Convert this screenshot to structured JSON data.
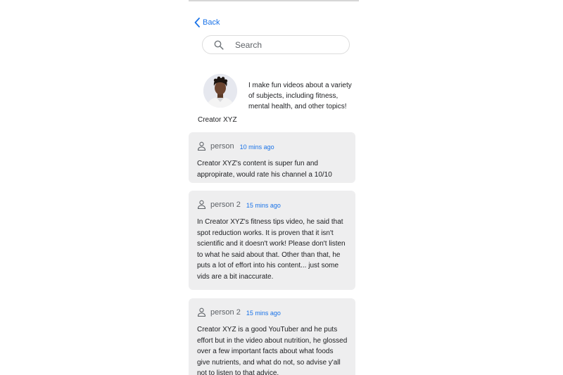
{
  "nav": {
    "back_label": "Back"
  },
  "search": {
    "placeholder": "Search"
  },
  "profile": {
    "name": "Creator XYZ",
    "bio": "I make fun videos about a variety of subjects, including fitness, mental health, and other topics!"
  },
  "comments": [
    {
      "user": "person",
      "time": "10 mins ago",
      "text": "Creator XYZ's content is super fun and appropirate, would rate his channel a 10/10"
    },
    {
      "user": "person 2",
      "time": "15 mins ago",
      "text": "In Creator XYZ's fitness tips video, he said that spot reduction works. It is proven that it isn't scientific and it doesn't work! Please don't listen to what he said about that. Other than that, he puts a lot of effort into his content... just some vids are a bit inaccurate."
    },
    {
      "user": "person 2",
      "time": "15 mins ago",
      "text": "Creator XYZ is a good YouTuber and he puts effort but in the video about nutrition, he glossed over a few important facts about what foods give nutrients, and what do not, so advise y'all not to listen to that advice."
    }
  ],
  "icons": {
    "back": "chevron-left-icon",
    "search": "search-icon",
    "user": "person-icon"
  },
  "colors": {
    "accent": "#1a73e8",
    "card_bg": "#eeeeef"
  }
}
